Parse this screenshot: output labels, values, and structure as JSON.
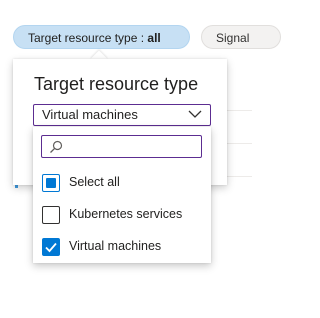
{
  "filters": {
    "target_resource_type": {
      "prefix": "Target resource type : ",
      "value": "all"
    },
    "signal": {
      "label": "Signal"
    }
  },
  "panel": {
    "title": "Target resource type",
    "selected_value": "Virtual machines"
  },
  "dropdown": {
    "search_placeholder": "",
    "options": [
      {
        "label": "Select all",
        "state": "indeterminate"
      },
      {
        "label": "Kubernetes services",
        "state": "unchecked"
      },
      {
        "label": "Virtual machines",
        "state": "checked"
      }
    ]
  },
  "colors": {
    "accent": "#0078d4",
    "focus_border": "#5c2d91",
    "active_pill_bg": "#c7e0f4"
  }
}
